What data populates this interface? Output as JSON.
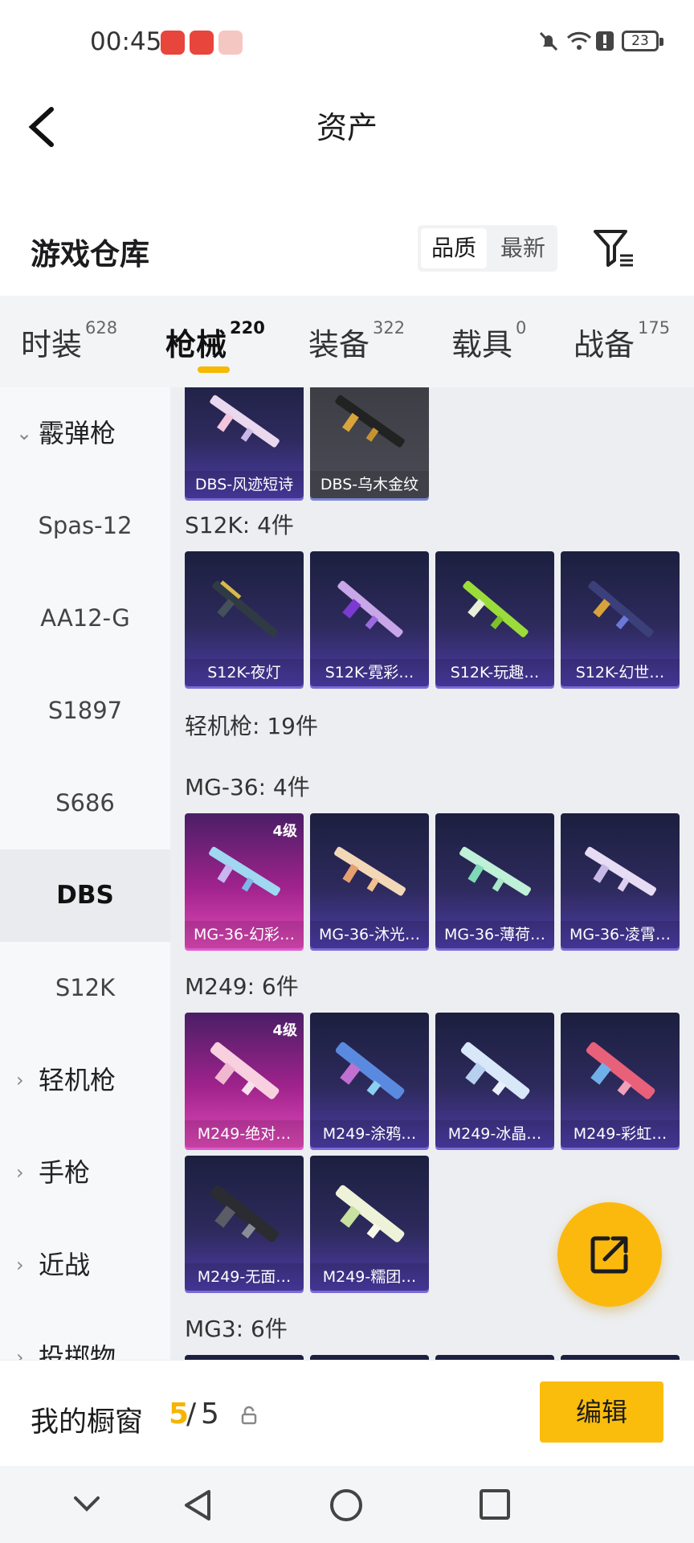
{
  "status_bar": {
    "time": "00:45",
    "battery": "23"
  },
  "header": {
    "title": "资产"
  },
  "warehouse": {
    "title": "游戏仓库",
    "sort_options": [
      "品质",
      "最新"
    ]
  },
  "tabs": [
    {
      "label": "时装",
      "count": "628"
    },
    {
      "label": "枪械",
      "count": "220"
    },
    {
      "label": "装备",
      "count": "322"
    },
    {
      "label": "载具",
      "count": "0"
    },
    {
      "label": "战备",
      "count": "175"
    }
  ],
  "sidebar": {
    "items": [
      "霰弹枪",
      "Spas-12",
      "AA12-G",
      "S1897",
      "S686",
      "DBS",
      "S12K",
      "轻机枪",
      "手枪",
      "近战",
      "投掷物"
    ]
  },
  "content": {
    "dbs_items": [
      "DBS-风迹短诗",
      "DBS-乌木金纹"
    ],
    "s12k_title": "S12K: 4件",
    "s12k_items": [
      "S12K-夜灯",
      "S12K-霓彩…",
      "S12K-玩趣…",
      "S12K-幻世…"
    ],
    "lmg_title": "轻机枪: 19件",
    "mg36_title": "MG-36: 4件",
    "mg36_items": [
      "MG-36-幻彩…",
      "MG-36-沐光…",
      "MG-36-薄荷…",
      "MG-36-凌霄…"
    ],
    "m249_title": "M249: 6件",
    "m249_items": [
      "M249-绝对…",
      "M249-涂鸦…",
      "M249-冰晶…",
      "M249-彩虹…",
      "M249-无面…",
      "M249-糯团…"
    ],
    "mg3_title": "MG3: 6件",
    "level_badge": "4级"
  },
  "bottom": {
    "my_window": "我的橱窗",
    "count_current": "5",
    "slash": "/",
    "count_total": "5",
    "edit_label": "编辑"
  },
  "colors": {
    "accent": "#fbbd0b",
    "card_purple": "#4d3ca8",
    "card_pink": "#e04ab8"
  }
}
